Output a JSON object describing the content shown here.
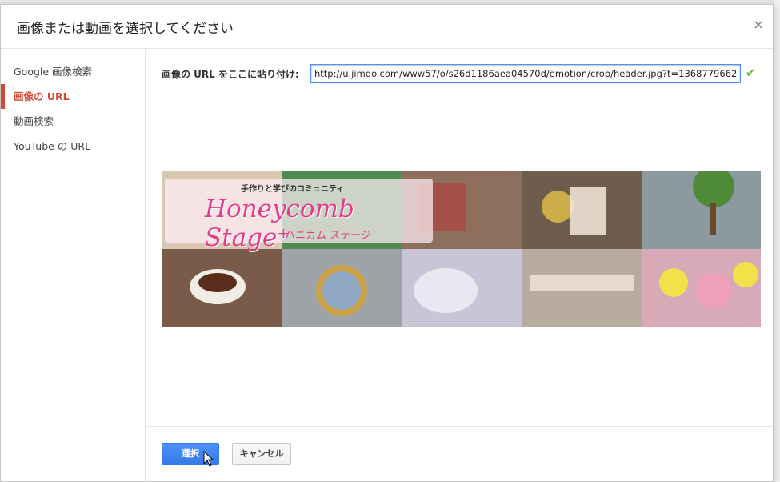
{
  "dialog": {
    "title": "画像または動画を選択してください",
    "close_label": "×"
  },
  "sidebar": {
    "items": [
      {
        "label": "Google 画像検索",
        "active": false
      },
      {
        "label": "画像の URL",
        "active": true
      },
      {
        "label": "動画検索",
        "active": false
      },
      {
        "label": "YouTube の URL",
        "active": false
      }
    ]
  },
  "url_field": {
    "label": "画像の URL をここに貼り付け:",
    "value": "http://u.jimdo.com/www57/o/s26d1186aea04570d/emotion/crop/header.jpg?t=1368779662"
  },
  "preview": {
    "banner_sub": "手作りと学びのコミュニティ",
    "banner_main": "Honeycomb Stage⁺",
    "banner_kana": "ハニカム ステージ"
  },
  "footer": {
    "select_label": "選択",
    "cancel_label": "キャンセル"
  },
  "colors": {
    "accent_red": "#d14836",
    "primary_blue": "#4d90fe",
    "check_green": "#6bb33a"
  }
}
